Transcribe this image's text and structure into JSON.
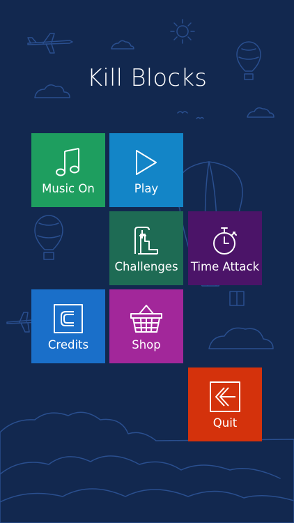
{
  "game": {
    "title": "Kill Blocks"
  },
  "menu": {
    "music": {
      "label": "Music On",
      "icon": "music-note-icon",
      "color": "#1e9e5f"
    },
    "play": {
      "label": "Play",
      "icon": "play-icon",
      "color": "#1385c7"
    },
    "challenges": {
      "label": "Challenges",
      "icon": "challenges-icon",
      "color": "#1e6b54"
    },
    "time_attack": {
      "label": "Time Attack",
      "icon": "stopwatch-icon",
      "color": "#4b1468"
    },
    "credits": {
      "label": "Credits",
      "icon": "credits-icon",
      "color": "#1a6fc9"
    },
    "shop": {
      "label": "Shop",
      "icon": "basket-icon",
      "color": "#a2279a"
    },
    "quit": {
      "label": "Quit",
      "icon": "back-arrow-icon",
      "color": "#d4320c"
    }
  },
  "colors": {
    "background": "#12284f",
    "line_art": "#2a4f8f"
  }
}
